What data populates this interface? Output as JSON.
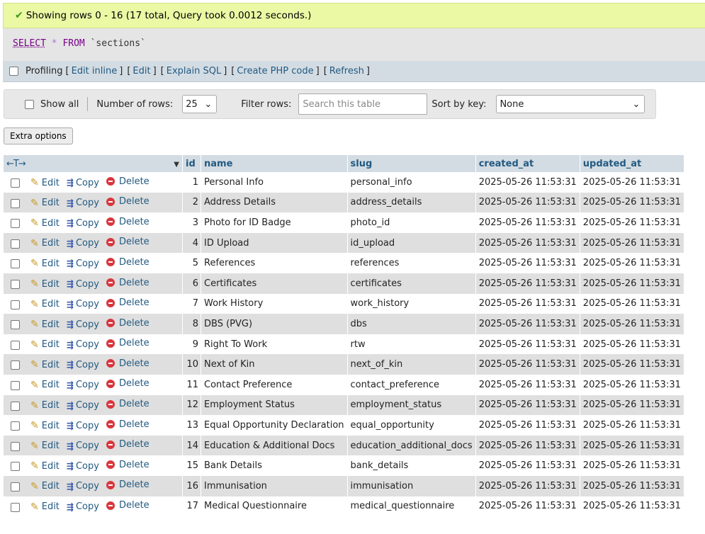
{
  "status": {
    "message": "Showing rows 0 - 16 (17 total, Query took 0.0012 seconds.)"
  },
  "sql": {
    "select": "SELECT",
    "star": "*",
    "from": "FROM",
    "table": "`sections`"
  },
  "profiling": {
    "label": "Profiling",
    "links": [
      "Edit inline",
      "Edit",
      "Explain SQL",
      "Create PHP code",
      "Refresh"
    ]
  },
  "nav": {
    "show_all": "Show all",
    "rows_label": "Number of rows:",
    "rows_value": "25",
    "filter_label": "Filter rows:",
    "filter_placeholder": "Search this table",
    "sort_label": "Sort by key:",
    "sort_value": "None"
  },
  "extra_options": "Extra options",
  "table": {
    "controls": "←T→",
    "columns": [
      "id",
      "name",
      "slug",
      "created_at",
      "updated_at"
    ],
    "actions": {
      "edit": "Edit",
      "copy": "Copy",
      "delete": "Delete"
    },
    "rows": [
      {
        "id": "1",
        "name": "Personal Info",
        "slug": "personal_info",
        "created_at": "2025-05-26 11:53:31",
        "updated_at": "2025-05-26 11:53:31"
      },
      {
        "id": "2",
        "name": "Address Details",
        "slug": "address_details",
        "created_at": "2025-05-26 11:53:31",
        "updated_at": "2025-05-26 11:53:31"
      },
      {
        "id": "3",
        "name": "Photo for ID Badge",
        "slug": "photo_id",
        "created_at": "2025-05-26 11:53:31",
        "updated_at": "2025-05-26 11:53:31"
      },
      {
        "id": "4",
        "name": "ID Upload",
        "slug": "id_upload",
        "created_at": "2025-05-26 11:53:31",
        "updated_at": "2025-05-26 11:53:31"
      },
      {
        "id": "5",
        "name": "References",
        "slug": "references",
        "created_at": "2025-05-26 11:53:31",
        "updated_at": "2025-05-26 11:53:31"
      },
      {
        "id": "6",
        "name": "Certificates",
        "slug": "certificates",
        "created_at": "2025-05-26 11:53:31",
        "updated_at": "2025-05-26 11:53:31"
      },
      {
        "id": "7",
        "name": "Work History",
        "slug": "work_history",
        "created_at": "2025-05-26 11:53:31",
        "updated_at": "2025-05-26 11:53:31"
      },
      {
        "id": "8",
        "name": "DBS (PVG)",
        "slug": "dbs",
        "created_at": "2025-05-26 11:53:31",
        "updated_at": "2025-05-26 11:53:31"
      },
      {
        "id": "9",
        "name": "Right To Work",
        "slug": "rtw",
        "created_at": "2025-05-26 11:53:31",
        "updated_at": "2025-05-26 11:53:31"
      },
      {
        "id": "10",
        "name": "Next of Kin",
        "slug": "next_of_kin",
        "created_at": "2025-05-26 11:53:31",
        "updated_at": "2025-05-26 11:53:31"
      },
      {
        "id": "11",
        "name": "Contact Preference",
        "slug": "contact_preference",
        "created_at": "2025-05-26 11:53:31",
        "updated_at": "2025-05-26 11:53:31"
      },
      {
        "id": "12",
        "name": "Employment Status",
        "slug": "employment_status",
        "created_at": "2025-05-26 11:53:31",
        "updated_at": "2025-05-26 11:53:31"
      },
      {
        "id": "13",
        "name": "Equal Opportunity Declaration",
        "slug": "equal_opportunity",
        "created_at": "2025-05-26 11:53:31",
        "updated_at": "2025-05-26 11:53:31"
      },
      {
        "id": "14",
        "name": "Education & Additional Docs",
        "slug": "education_additional_docs",
        "created_at": "2025-05-26 11:53:31",
        "updated_at": "2025-05-26 11:53:31"
      },
      {
        "id": "15",
        "name": "Bank Details",
        "slug": "bank_details",
        "created_at": "2025-05-26 11:53:31",
        "updated_at": "2025-05-26 11:53:31"
      },
      {
        "id": "16",
        "name": "Immunisation",
        "slug": "immunisation",
        "created_at": "2025-05-26 11:53:31",
        "updated_at": "2025-05-26 11:53:31"
      },
      {
        "id": "17",
        "name": "Medical Questionnaire",
        "slug": "medical_questionnaire",
        "created_at": "2025-05-26 11:53:31",
        "updated_at": "2025-05-26 11:53:31"
      }
    ]
  }
}
